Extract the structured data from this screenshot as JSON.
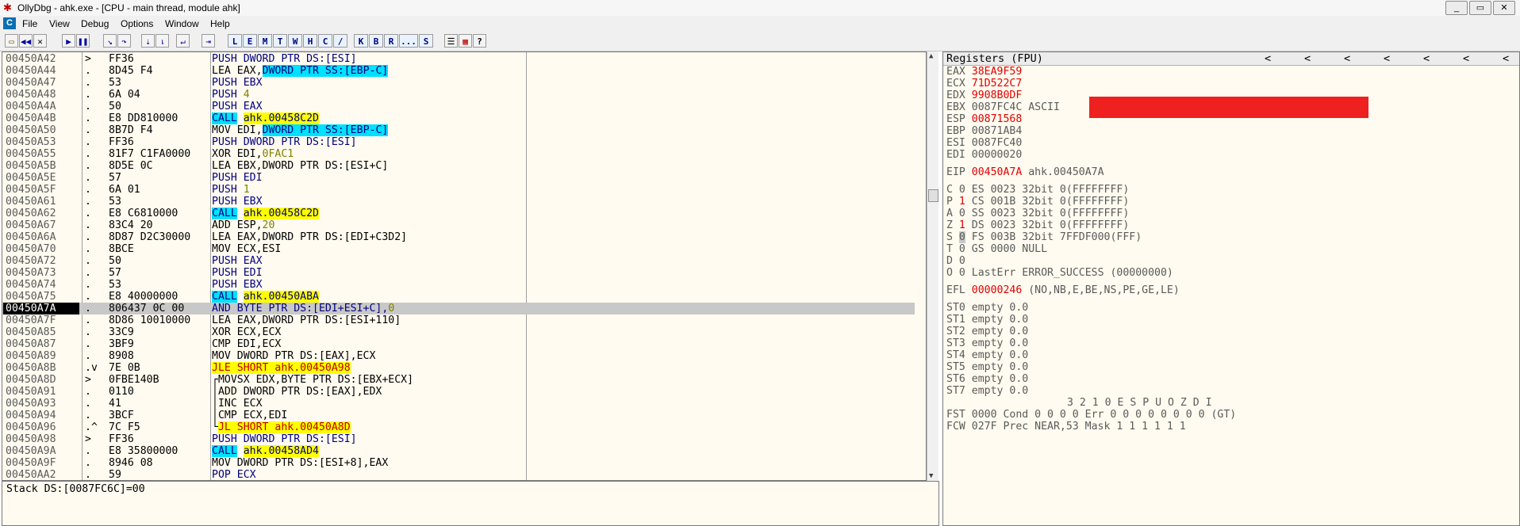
{
  "window": {
    "title": "OllyDbg - ahk.exe - [CPU - main thread, module ahk]",
    "buttons": [
      "_",
      "▭",
      "✕"
    ]
  },
  "menu": {
    "app_icon": "C",
    "items": [
      "File",
      "View",
      "Debug",
      "Options",
      "Window",
      "Help"
    ]
  },
  "toolbar": {
    "icons": [
      "open-icon",
      "restart-icon",
      "close-icon",
      "run-icon",
      "pause-icon",
      "step-into-icon",
      "step-over-icon",
      "trace-into-icon",
      "trace-over-icon",
      "execute-till-return-icon",
      "goto-icon"
    ],
    "letters": [
      "L",
      "E",
      "M",
      "T",
      "W",
      "H",
      "C",
      "/",
      "K",
      "B",
      "R",
      "...",
      "S"
    ],
    "right_icons": [
      "list-icon",
      "grid-icon",
      "help-icon"
    ],
    "help_label": "?"
  },
  "disasm": {
    "rows": [
      {
        "addr": "00450A42",
        "mark": ">",
        "hex": "FF36",
        "ins": [
          {
            "t": "PUSH DWORD PTR DS:[ESI]",
            "c": "kw"
          }
        ]
      },
      {
        "addr": "00450A44",
        "mark": ".",
        "hex": "8D45 F4",
        "ins": [
          {
            "t": "LEA EAX,",
            "c": ""
          },
          {
            "t": "DWORD PTR SS:[EBP-C]",
            "c": "mem"
          }
        ]
      },
      {
        "addr": "00450A47",
        "mark": ".",
        "hex": "53",
        "ins": [
          {
            "t": "PUSH EBX",
            "c": "kw"
          }
        ]
      },
      {
        "addr": "00450A48",
        "mark": ".",
        "hex": "6A 04",
        "ins": [
          {
            "t": "PUSH ",
            "c": "kw"
          },
          {
            "t": "4",
            "c": "num"
          }
        ]
      },
      {
        "addr": "00450A4A",
        "mark": ".",
        "hex": "50",
        "ins": [
          {
            "t": "PUSH EAX",
            "c": "kw"
          }
        ]
      },
      {
        "addr": "00450A4B",
        "mark": ".",
        "hex": "E8 DD810000",
        "ins": [
          {
            "t": "CALL",
            "c": "call"
          },
          {
            "t": " ",
            "c": ""
          },
          {
            "t": "ahk.00458C2D",
            "c": "tgt"
          }
        ]
      },
      {
        "addr": "00450A50",
        "mark": ".",
        "hex": "8B7D F4",
        "ins": [
          {
            "t": "MOV EDI,",
            "c": ""
          },
          {
            "t": "DWORD PTR SS:[EBP-C]",
            "c": "mem"
          }
        ]
      },
      {
        "addr": "00450A53",
        "mark": ".",
        "hex": "FF36",
        "ins": [
          {
            "t": "PUSH DWORD PTR DS:[ESI]",
            "c": "kw"
          }
        ]
      },
      {
        "addr": "00450A55",
        "mark": ".",
        "hex": "81F7 C1FA0000",
        "ins": [
          {
            "t": "XOR EDI,",
            "c": ""
          },
          {
            "t": "0FAC1",
            "c": "num"
          }
        ]
      },
      {
        "addr": "00450A5B",
        "mark": ".",
        "hex": "8D5E 0C",
        "ins": [
          {
            "t": "LEA EBX,DWORD PTR DS:[ESI+C]",
            "c": ""
          }
        ]
      },
      {
        "addr": "00450A5E",
        "mark": ".",
        "hex": "57",
        "ins": [
          {
            "t": "PUSH EDI",
            "c": "kw"
          }
        ]
      },
      {
        "addr": "00450A5F",
        "mark": ".",
        "hex": "6A 01",
        "ins": [
          {
            "t": "PUSH ",
            "c": "kw"
          },
          {
            "t": "1",
            "c": "num"
          }
        ]
      },
      {
        "addr": "00450A61",
        "mark": ".",
        "hex": "53",
        "ins": [
          {
            "t": "PUSH EBX",
            "c": "kw"
          }
        ]
      },
      {
        "addr": "00450A62",
        "mark": ".",
        "hex": "E8 C6810000",
        "ins": [
          {
            "t": "CALL",
            "c": "call"
          },
          {
            "t": " ",
            "c": ""
          },
          {
            "t": "ahk.00458C2D",
            "c": "tgt"
          }
        ]
      },
      {
        "addr": "00450A67",
        "mark": ".",
        "hex": "83C4 20",
        "ins": [
          {
            "t": "ADD ESP,",
            "c": ""
          },
          {
            "t": "20",
            "c": "num"
          }
        ]
      },
      {
        "addr": "00450A6A",
        "mark": ".",
        "hex": "8D87 D2C30000",
        "ins": [
          {
            "t": "LEA EAX,DWORD PTR DS:[EDI+C3D2]",
            "c": ""
          }
        ]
      },
      {
        "addr": "00450A70",
        "mark": ".",
        "hex": "8BCE",
        "ins": [
          {
            "t": "MOV ECX,ESI",
            "c": ""
          }
        ]
      },
      {
        "addr": "00450A72",
        "mark": ".",
        "hex": "50",
        "ins": [
          {
            "t": "PUSH EAX",
            "c": "kw"
          }
        ]
      },
      {
        "addr": "00450A73",
        "mark": ".",
        "hex": "57",
        "ins": [
          {
            "t": "PUSH EDI",
            "c": "kw"
          }
        ]
      },
      {
        "addr": "00450A74",
        "mark": ".",
        "hex": "53",
        "ins": [
          {
            "t": "PUSH EBX",
            "c": "kw"
          }
        ]
      },
      {
        "addr": "00450A75",
        "mark": ".",
        "hex": "E8 40000000",
        "ins": [
          {
            "t": "CALL",
            "c": "call"
          },
          {
            "t": " ",
            "c": ""
          },
          {
            "t": "ahk.00450ABA",
            "c": "tgt"
          }
        ]
      },
      {
        "addr": "00450A7A",
        "mark": ".",
        "hex": "806437 0C 00",
        "ins": [
          {
            "t": "AND BYTE PTR DS:[EDI+ESI+C],",
            "c": "kw"
          },
          {
            "t": "0",
            "c": "num"
          }
        ],
        "selected": true
      },
      {
        "addr": "00450A7F",
        "mark": ".",
        "hex": "8D86 10010000",
        "ins": [
          {
            "t": "LEA EAX,DWORD PTR DS:[ESI+110]",
            "c": ""
          }
        ]
      },
      {
        "addr": "00450A85",
        "mark": ".",
        "hex": "33C9",
        "ins": [
          {
            "t": "XOR ECX,ECX",
            "c": ""
          }
        ]
      },
      {
        "addr": "00450A87",
        "mark": ".",
        "hex": "3BF9",
        "ins": [
          {
            "t": "CMP EDI,ECX",
            "c": ""
          }
        ]
      },
      {
        "addr": "00450A89",
        "mark": ".",
        "hex": "8908",
        "ins": [
          {
            "t": "MOV DWORD PTR DS:[EAX],ECX",
            "c": ""
          }
        ]
      },
      {
        "addr": "00450A8B",
        "mark": ".v",
        "hex": "7E 0B",
        "ins": [
          {
            "t": "JLE SHORT ahk.00450A98",
            "c": "jcc"
          }
        ]
      },
      {
        "addr": "00450A8D",
        "mark": ">",
        "hex": "0FBE140B",
        "ins": [
          {
            "t": "┌MOVSX EDX,BYTE PTR DS:[EBX+ECX]",
            "c": ""
          }
        ]
      },
      {
        "addr": "00450A91",
        "mark": ".",
        "hex": "0110",
        "ins": [
          {
            "t": "│ADD DWORD PTR DS:[EAX],EDX",
            "c": ""
          }
        ]
      },
      {
        "addr": "00450A93",
        "mark": ".",
        "hex": "41",
        "ins": [
          {
            "t": "│INC ECX",
            "c": ""
          }
        ]
      },
      {
        "addr": "00450A94",
        "mark": ".",
        "hex": "3BCF",
        "ins": [
          {
            "t": "│CMP ECX,EDI",
            "c": ""
          }
        ]
      },
      {
        "addr": "00450A96",
        "mark": ".^",
        "hex": "7C F5",
        "ins": [
          {
            "t": "└",
            "c": ""
          },
          {
            "t": "JL SHORT ahk.00450A8D",
            "c": "jcc"
          }
        ]
      },
      {
        "addr": "00450A98",
        "mark": ">",
        "hex": "FF36",
        "ins": [
          {
            "t": "PUSH DWORD PTR DS:[ESI]",
            "c": "kw"
          }
        ]
      },
      {
        "addr": "00450A9A",
        "mark": ".",
        "hex": "E8 35800000",
        "ins": [
          {
            "t": "CALL",
            "c": "call"
          },
          {
            "t": " ",
            "c": ""
          },
          {
            "t": "ahk.00458AD4",
            "c": "tgt"
          }
        ]
      },
      {
        "addr": "00450A9F",
        "mark": ".",
        "hex": "8946 08",
        "ins": [
          {
            "t": "MOV DWORD PTR DS:[ESI+8],EAX",
            "c": ""
          }
        ]
      },
      {
        "addr": "00450AA2",
        "mark": ".",
        "hex": "59",
        "ins": [
          {
            "t": "POP ECX",
            "c": "kw"
          }
        ]
      }
    ]
  },
  "info_pane": {
    "text": "Stack DS:[0087FC6C]=00"
  },
  "registers": {
    "header": "Registers (FPU)",
    "arrows": [
      "<",
      "<",
      "<",
      "<",
      "<",
      "<",
      "<"
    ],
    "gp": [
      {
        "name": "EAX",
        "value": "38EA9F59",
        "changed": true,
        "extra": ""
      },
      {
        "name": "ECX",
        "value": "71D522C7",
        "changed": true,
        "extra": ""
      },
      {
        "name": "EDX",
        "value": "9908B0DF",
        "changed": true,
        "extra": ""
      },
      {
        "name": "EBX",
        "value": "0087FC4C",
        "changed": false,
        "extra": "ASCII"
      },
      {
        "name": "ESP",
        "value": "00871568",
        "changed": true,
        "extra": ""
      },
      {
        "name": "EBP",
        "value": "00871AB4",
        "changed": false,
        "extra": ""
      },
      {
        "name": "ESI",
        "value": "0087FC40",
        "changed": false,
        "extra": ""
      },
      {
        "name": "EDI",
        "value": "00000020",
        "changed": false,
        "extra": ""
      }
    ],
    "eip": {
      "name": "EIP",
      "value": "00450A7A",
      "comment": "ahk.00450A7A"
    },
    "flags": [
      {
        "f": "C",
        "v": "0",
        "chg": false,
        "seg": "ES 0023 32bit 0(FFFFFFFF)"
      },
      {
        "f": "P",
        "v": "1",
        "chg": true,
        "seg": "CS 001B 32bit 0(FFFFFFFF)"
      },
      {
        "f": "A",
        "v": "0",
        "chg": false,
        "seg": "SS 0023 32bit 0(FFFFFFFF)"
      },
      {
        "f": "Z",
        "v": "1",
        "chg": true,
        "seg": "DS 0023 32bit 0(FFFFFFFF)"
      },
      {
        "f": "S",
        "v": "0",
        "chg": false,
        "seg": "FS 003B 32bit 7FFDF000(FFF)"
      },
      {
        "f": "T",
        "v": "0",
        "chg": false,
        "seg": "GS 0000 NULL"
      },
      {
        "f": "D",
        "v": "0",
        "chg": false,
        "seg": ""
      },
      {
        "f": "O",
        "v": "0",
        "chg": false,
        "seg": "LastErr ERROR_SUCCESS (00000000)"
      }
    ],
    "efl": {
      "name": "EFL",
      "value": "00000246",
      "decoded": "(NO,NB,E,BE,NS,PE,GE,LE)"
    },
    "st": [
      "ST0 empty 0.0",
      "ST1 empty 0.0",
      "ST2 empty 0.0",
      "ST3 empty 0.0",
      "ST4 empty 0.0",
      "ST5 empty 0.0",
      "ST6 empty 0.0",
      "ST7 empty 0.0"
    ],
    "fpu_header": "3 2 1 0      E S P U O Z D I",
    "fst": "FST 0000  Cond 0 0 0 0  Err 0 0 0 0 0 0 0 0  (GT)",
    "fcw": "FCW 027F  Prec NEAR,53  Mask    1 1 1 1 1 1"
  },
  "colors": {
    "changed": "#e00000",
    "call_bg": "#00e0ff",
    "jump_bg": "#ffff00",
    "redacted": "#ee2020",
    "pane_bg": "#fffbf0"
  }
}
